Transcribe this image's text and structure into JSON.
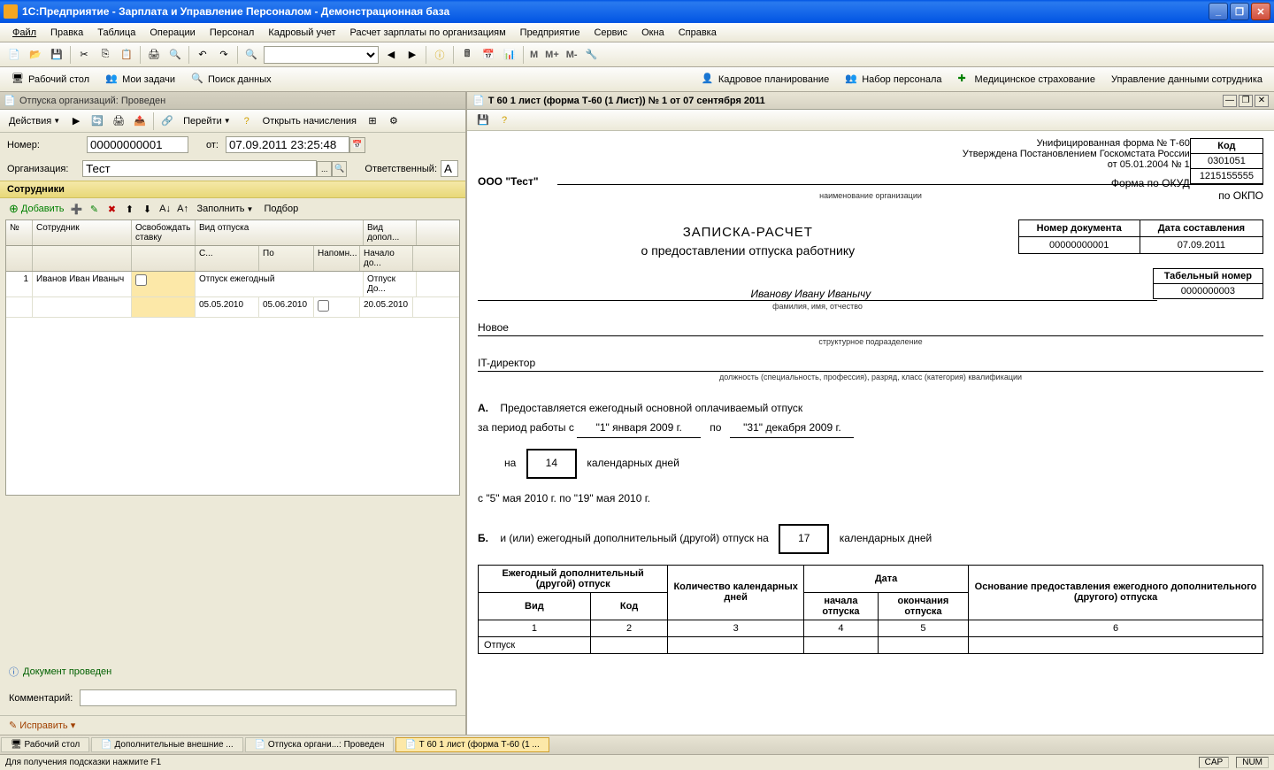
{
  "titlebar": {
    "text": "1С:Предприятие - Зарплата и Управление Персоналом - Демонстрационная база"
  },
  "menu": {
    "file": "Файл",
    "edit": "Правка",
    "table": "Таблица",
    "ops": "Операции",
    "staff": "Персонал",
    "hr": "Кадровый учет",
    "payroll": "Расчет зарплаты по организациям",
    "enterprise": "Предприятие",
    "service": "Сервис",
    "windows": "Окна",
    "help": "Справка"
  },
  "toolbar_marks": {
    "m": "M",
    "mplus": "M+",
    "mminus": "M-"
  },
  "toolbar2": {
    "desktop": "Рабочий стол",
    "tasks": "Мои задачи",
    "search": "Поиск данных",
    "plan": "Кадровое планирование",
    "recruit": "Набор персонала",
    "med": "Медицинское страхование",
    "mgmt": "Управление данными сотрудника"
  },
  "leftdoc": {
    "title": "Отпуска организаций: Проведен",
    "actions": "Действия",
    "goto": "Перейти",
    "open_calc": "Открыть начисления",
    "number_lbl": "Номер:",
    "number": "00000000001",
    "from_lbl": "от:",
    "date": "07.09.2011 23:25:48",
    "org_lbl": "Организация:",
    "org": "Тест",
    "resp_lbl": "Ответственный:",
    "resp": "А",
    "section": "Сотрудники",
    "add": "Добавить",
    "fill": "Заполнить",
    "select": "Подбор",
    "grid": {
      "h_num": "№",
      "h_emp": "Сотрудник",
      "h_free": "Освобождать ставку",
      "h_type": "Вид отпуска",
      "h_from": "С...",
      "h_to": "По",
      "h_remind": "Напомн...",
      "h_extra": "Вид допол...",
      "h_start": "Начало до...",
      "r1_num": "1",
      "r1_emp": "Иванов Иван Иваныч",
      "r1_type": "Отпуск ежегодный",
      "r1_from": "05.05.2010",
      "r1_to": "05.06.2010",
      "r1_extra": "Отпуск До...",
      "r1_start": "20.05.2010"
    },
    "status": "Документ проведен",
    "comment_lbl": "Комментарий:",
    "fix": "Исправить"
  },
  "rightdoc": {
    "title": "Т 60 1 лист (форма Т-60 (1 Лист)) № 1 от 07 сентября 2011",
    "form_header1": "Унифицированная форма № Т-60",
    "form_header2": "Утверждена Постановлением Госкомстата России",
    "form_header3": "от 05.01.2004 № 1",
    "code_hdr": "Код",
    "okud_lbl": "Форма по ОКУД",
    "okud": "0301051",
    "okpo_lbl": "по ОКПО",
    "okpo": "1215155555",
    "org": "ООО \"Тест\"",
    "org_caption": "наименование организации",
    "docnum_hdr": "Номер документа",
    "docdate_hdr": "Дата составления",
    "docnum": "00000000001",
    "docdate": "07.09.2011",
    "title1": "ЗАПИСКА-РАСЧЕТ",
    "title2": "о предоставлении отпуска работнику",
    "tabnum_hdr": "Табельный номер",
    "tabnum": "0000000003",
    "emp": "Иванову Ивану Иванычу",
    "emp_caption": "фамилия, имя, отчество",
    "dept": "Новое",
    "dept_caption": "структурное подразделение",
    "pos": "IT-директор",
    "pos_caption": "должность (специальность, профессия), разряд, класс (категория) квалификации",
    "sec_a": "А.",
    "sec_a_text": "Предоставляется ежегодный основной оплачиваемый отпуск",
    "period_lbl": "за период работы с",
    "period_from": "\"1\" января 2009 г.",
    "period_to_lbl": "по",
    "period_to": "\"31\" декабря 2009 г.",
    "days_lbl": "на",
    "days": "14",
    "days_suffix": "календарных дней",
    "range": "с \"5\" мая 2010 г.  по \"19\" мая 2010 г.",
    "sec_b": "Б.",
    "sec_b_text": "и (или) ежегодный дополнительный (другой) отпуск на",
    "sec_b_days": "17",
    "sec_b_suffix": "календарных дней",
    "bt": {
      "h1": "Ежегодный дополнительный (другой) отпуск",
      "h1a": "Вид",
      "h1b": "Код",
      "h2": "Количество календарных дней",
      "h3": "Дата",
      "h3a": "начала отпуска",
      "h3b": "окончания отпуска",
      "h4": "Основание предоставления ежегодного дополнительного (другого) отпуска",
      "c1": "1",
      "c2": "2",
      "c3": "3",
      "c4": "4",
      "c5": "5",
      "c6": "6",
      "r_type": "Отпуск"
    }
  },
  "taskbar": {
    "t1": "Рабочий стол",
    "t2": "Дополнительные внешние ...",
    "t3": "Отпуска органи...: Проведен",
    "t4": "Т 60 1 лист (форма Т-60 (1 ..."
  },
  "statusbar": {
    "hint": "Для получения подсказки нажмите F1",
    "cap": "CAP",
    "num": "NUM"
  }
}
